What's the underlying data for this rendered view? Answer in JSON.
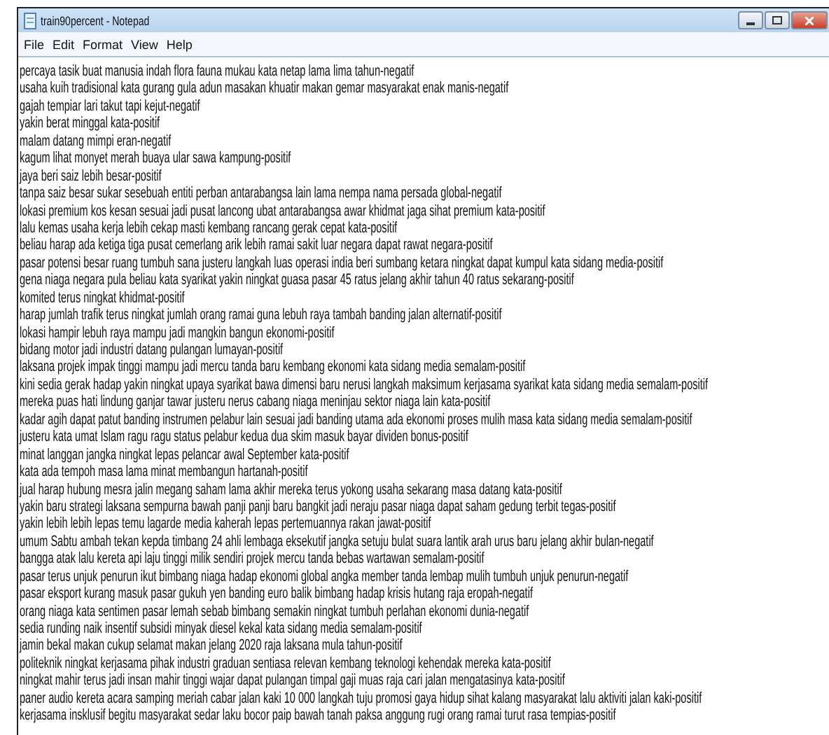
{
  "window": {
    "title": "train90percent - Notepad"
  },
  "menu": [
    "File",
    "Edit",
    "Format",
    "View",
    "Help"
  ],
  "lines": [
    "percaya tasik buat manusia indah flora fauna mukau kata netap lama lima tahun-negatif",
    "usaha kuih tradisional kata gurang gula adun masakan khuatir makan gemar masyarakat enak manis-negatif",
    "gajah tempiar lari takut tapi kejut-negatif",
    "yakin berat minggal kata-positif",
    "malam datang mimpi eran-negatif",
    "kagum lihat monyet merah buaya ular sawa kampung-positif",
    "jaya beri saiz lebih besar-positif",
    "tanpa saiz besar sukar sesebuah entiti perban antarabangsa lain lama nempa nama persada global-negatif",
    "lokasi premium kos kesan sesuai jadi pusat lancong ubat antarabangsa awar khidmat jaga sihat premium kata-positif",
    "lalu kemas usaha kerja lebih cekap masti kembang rancang gerak cepat kata-positif",
    "beliau harap ada ketiga tiga pusat cemerlang arik lebih ramai sakit luar negara dapat rawat negara-positif",
    "pasar potensi besar ruang tumbuh sana justeru langkah luas operasi india beri sumbang ketara ningkat dapat kumpul kata sidang media-positif",
    "gena niaga negara pula beliau kata syarikat yakin ningkat guasa pasar 45 ratus jelang akhir tahun 40 ratus sekarang-positif",
    "komited terus ningkat khidmat-positif",
    "harap jumlah trafik terus ningkat jumlah orang ramai guna lebuh raya tambah banding jalan alternatif-positif",
    "lokasi hampir lebuh raya mampu jadi mangkin bangun ekonomi-positif",
    "bidang motor jadi industri datang pulangan lumayan-positif",
    "laksana projek impak tinggi mampu jadi mercu tanda baru kembang ekonomi kata sidang media semalam-positif",
    "kini sedia gerak hadap yakin ningkat upaya syarikat bawa dimensi baru nerusi langkah maksimum kerjasama syarikat kata sidang media semalam-positif",
    "mereka puas hati lindung ganjar tawar justeru nerus cabang niaga meninjau sektor niaga lain kata-positif",
    "kadar agih dapat patut banding instrumen pelabur lain sesuai jadi banding utama ada ekonomi proses mulih masa kata sidang media semalam-positif",
    "justeru kata umat Islam ragu ragu status pelabur kedua dua skim masuk bayar dividen bonus-positif",
    "minat langgan jangka ningkat lepas pelancar awal September kata-positif",
    "kata ada tempoh masa lama minat membangun hartanah-positif",
    "jual harap hubung mesra jalin megang saham lama akhir mereka terus yokong usaha sekarang masa datang kata-positif",
    "yakin baru strategi laksana sempurna bawah panji panji baru bangkit jadi neraju pasar niaga dapat saham gedung terbit tegas-positif",
    "yakin lebih lebih lepas temu lagarde media kaherah lepas pertemuannya rakan jawat-positif",
    "umum Sabtu ambah tekan kepda timbang 24 ahli lembaga eksekutif jangka setuju bulat suara lantik arah urus baru jelang akhir bulan-negatif",
    "bangga atak lalu kereta api laju tinggi milik sendiri projek mercu tanda bebas wartawan semalam-positif",
    "pasar terus unjuk penurun ikut bimbang niaga hadap ekonomi global angka member tanda lembap mulih tumbuh unjuk penurun-negatif",
    "pasar eksport kurang masuk pasar gukuh yen banding euro balik bimbang hadap krisis hutang raja eropah-negatif",
    "orang niaga kata sentimen pasar lemah sebab bimbang semakin ningkat tumbuh perlahan ekonomi dunia-negatif",
    "sedia runding naik insentif subsidi minyak diesel kekal kata sidang media semalam-positif",
    "jamin bekal makan cukup selamat makan jelang 2020 raja laksana mula tahun-positif",
    "politeknik ningkat kerjasama pihak industri graduan sentiasa relevan kembang teknologi kehendak mereka kata-positif",
    "ningkat mahir terus jadi insan mahir tinggi wajar dapat pulangan timpal gaji muas raja cari jalan mengatasinya kata-positif",
    "paner audio kereta acara samping meriah cabar jalan kaki 10 000 langkah tuju promosi gaya hidup sihat kalang masyarakat lalu aktiviti jalan kaki-positif",
    "kerjasama insklusif begitu masyarakat sedar laku bocor paip bawah tanah paksa anggung rugi orang ramai turut rasa tempias-positif"
  ]
}
